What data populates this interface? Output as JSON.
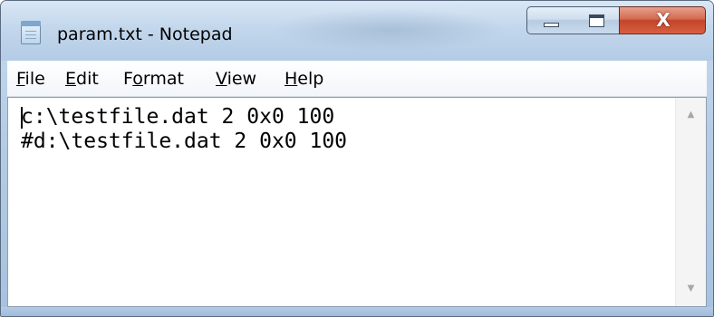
{
  "window": {
    "title": "param.txt - Notepad",
    "close_glyph": "X"
  },
  "menu": [
    {
      "mnemonic": "F",
      "rest": "ile"
    },
    {
      "mnemonic": "E",
      "rest": "dit"
    },
    {
      "before": "F",
      "mnemonic": "o",
      "rest": "rmat"
    },
    {
      "mnemonic": "V",
      "rest": "iew"
    },
    {
      "mnemonic": "H",
      "rest": "elp"
    }
  ],
  "editor": {
    "lines": [
      "c:\\testfile.dat 2 0x0 100",
      "#d:\\testfile.dat 2 0x0 100"
    ]
  },
  "scrollbar": {
    "up_glyph": "▲",
    "down_glyph": "▼"
  },
  "icons": {
    "app": "notepad-icon",
    "minimize": "minimize-icon",
    "maximize": "maximize-icon",
    "close": "close-icon"
  },
  "colors": {
    "frame": "#b5cde6",
    "close_button": "#c2442a",
    "editor_background": "#ffffff"
  }
}
